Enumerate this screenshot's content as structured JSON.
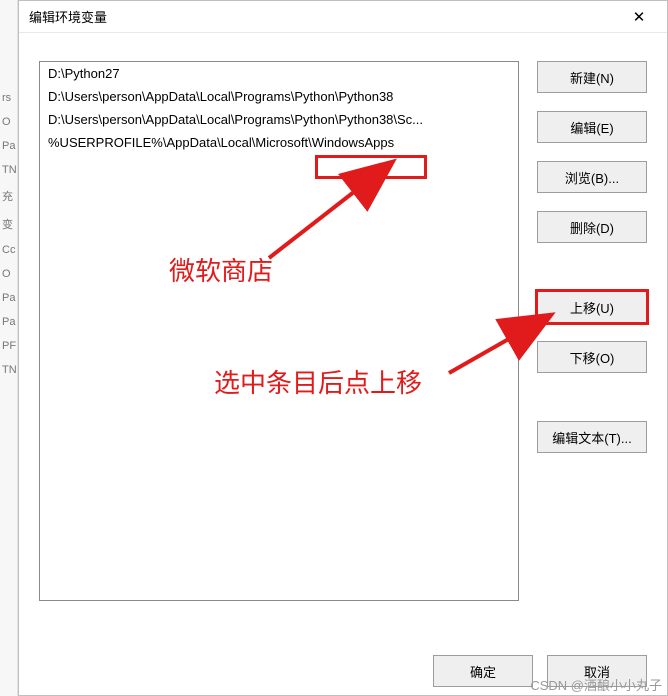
{
  "window": {
    "title": "编辑环境变量",
    "close_glyph": "✕"
  },
  "list": {
    "items": [
      "D:\\Python27",
      "D:\\Users\\person\\AppData\\Local\\Programs\\Python\\Python38",
      "D:\\Users\\person\\AppData\\Local\\Programs\\Python\\Python38\\Sc...",
      "%USERPROFILE%\\AppData\\Local\\Microsoft\\WindowsApps"
    ]
  },
  "buttons": {
    "new": "新建(N)",
    "edit": "编辑(E)",
    "browse": "浏览(B)...",
    "delete": "删除(D)",
    "moveup": "上移(U)",
    "movedown": "下移(O)",
    "edittext": "编辑文本(T)...",
    "ok": "确定",
    "cancel": "取消"
  },
  "annotations": {
    "label1": "微软商店",
    "label2": "选中条目后点上移"
  },
  "watermark": "CSDN @酒酿小小丸子",
  "behind_hints": [
    "rs",
    "O",
    "Pa",
    "TN",
    "充",
    "变",
    "Cc",
    "O",
    "Pa",
    "Pa",
    "PF",
    "TN"
  ]
}
